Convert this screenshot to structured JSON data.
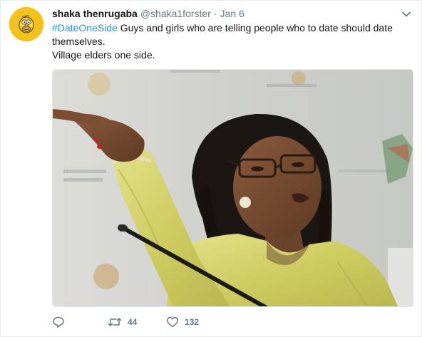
{
  "tweet": {
    "display_name": "shaka thenrugaba",
    "username": "@shaka1forster",
    "separator": "·",
    "timestamp": "Jan 6",
    "hashtag": "#DateOneSide",
    "text_after_hashtag": " Guys and girls who are telling people who to date should date themselves.",
    "text_line2": "Village elders one side.",
    "retweet_count": "44",
    "like_count": "132"
  },
  "icons": {
    "avatar": "homer-simpson-avatar",
    "caret": "chevron-down-icon",
    "reply": "reply-icon",
    "retweet": "retweet-icon",
    "like": "heart-icon"
  },
  "colors": {
    "link": "#1b95e0",
    "secondary_text": "#657786",
    "avatar_bg": "#f4c21a"
  }
}
